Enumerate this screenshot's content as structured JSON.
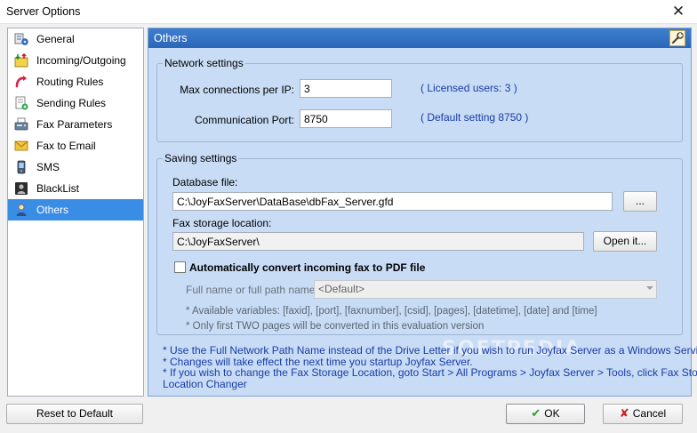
{
  "window": {
    "title": "Server Options",
    "close_glyph": "✕"
  },
  "sidebar": {
    "items": [
      {
        "label": "General",
        "icon": "general-icon",
        "selected": false
      },
      {
        "label": "Incoming/Outgoing",
        "icon": "inout-icon",
        "selected": false
      },
      {
        "label": "Routing Rules",
        "icon": "routing-icon",
        "selected": false
      },
      {
        "label": "Sending Rules",
        "icon": "sending-icon",
        "selected": false
      },
      {
        "label": "Fax Parameters",
        "icon": "fax-icon",
        "selected": false
      },
      {
        "label": "Fax to Email",
        "icon": "email-icon",
        "selected": false
      },
      {
        "label": "SMS",
        "icon": "sms-icon",
        "selected": false
      },
      {
        "label": "BlackList",
        "icon": "blacklist-icon",
        "selected": false
      },
      {
        "label": "Others",
        "icon": "others-icon",
        "selected": true
      }
    ]
  },
  "panel": {
    "title": "Others",
    "network": {
      "legend": "Network settings",
      "max_conn_label": "Max connections per IP:",
      "max_conn_value": "3",
      "licensed_note": "( Licensed users: 3 )",
      "port_label": "Communication Port:",
      "port_value": "8750",
      "port_note": "( Default setting 8750 )"
    },
    "saving": {
      "legend": "Saving settings",
      "db_label": "Database file:",
      "db_value": "C:\\JoyFaxServer\\DataBase\\dbFax_Server.gfd",
      "browse_label": "...",
      "storage_label": "Fax storage location:",
      "storage_value": "C:\\JoyFaxServer\\",
      "open_label": "Open it...",
      "convert_label": "Automatically convert incoming fax to PDF file",
      "convert_checked": false,
      "fullname_label": "Full name or full path name:",
      "fullname_value": "<Default>",
      "variables_hint": "* Available variables: [faxid], [port], [faxnumber], [csid], [pages], [datetime], [date] and [time]",
      "eval_hint": "* Only first TWO pages will be converted in this evaluation version"
    },
    "notes": [
      "* Use the Full Network Path Name instead of the Drive Letter if you wish to run Joyfax Server as a Windows Service.",
      "* Changes will take effect the next time you startup Joyfax Server.",
      "* If you wish to change the Fax Storage Location, goto Start > All Programs > Joyfax Server > Tools, click Fax Storage",
      "Location Changer"
    ],
    "watermark": "SOFTPEDIA"
  },
  "footer": {
    "reset_label": "Reset to Default",
    "ok_label": "OK",
    "ok_glyph": "✔",
    "cancel_label": "Cancel",
    "cancel_glyph": "✘"
  },
  "colors": {
    "accent": "#3a8de4",
    "panel_bg": "#c8dcf5",
    "note_blue": "#1a3ca6",
    "ok_green": "#2e9a2e",
    "cancel_red": "#cc1f1f"
  }
}
